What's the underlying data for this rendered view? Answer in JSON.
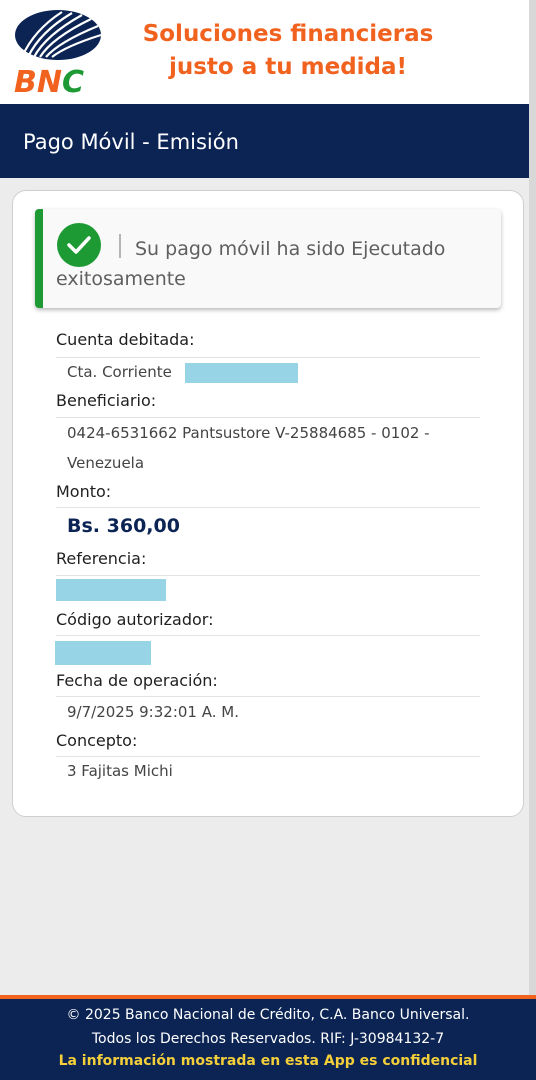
{
  "header": {
    "logo_text": "BNC",
    "tagline_line1": "Soluciones financieras",
    "tagline_line2": "justo a tu medida!"
  },
  "titlebar": {
    "title": "Pago Móvil - Emisión"
  },
  "alert": {
    "icon": "check-circle-icon",
    "message": "Su pago móvil ha sido Ejecutado exitosamente"
  },
  "details": {
    "cuenta_label": "Cuenta debitada:",
    "cuenta_value": "Cta. Corriente",
    "beneficiario_label": "Beneficiario:",
    "beneficiario_line1": "0424-6531662 Pantsustore V-25884685 - 0102 -",
    "beneficiario_line2": "Venezuela",
    "monto_label": "Monto:",
    "monto_value": "Bs. 360,00",
    "referencia_label": "Referencia:",
    "codigo_label": "Código autorizador:",
    "fecha_label": "Fecha de operación:",
    "fecha_value": "9/7/2025 9:32:01 A. M.",
    "concepto_label": "Concepto:",
    "concepto_value": "3 Fajitas Michi"
  },
  "footer": {
    "line1": "© 2025 Banco Nacional de Crédito, C.A. Banco Universal.",
    "line2": "Todos los Derechos Reservados. RIF: J-30984132-7",
    "line3": "La información mostrada en esta App es confidencial"
  },
  "colors": {
    "brand_navy": "#0b2454",
    "brand_orange": "#f0621e",
    "success_green": "#1e9a34",
    "redaction": "#96d4e6",
    "footer_highlight": "#f4cf3a"
  }
}
